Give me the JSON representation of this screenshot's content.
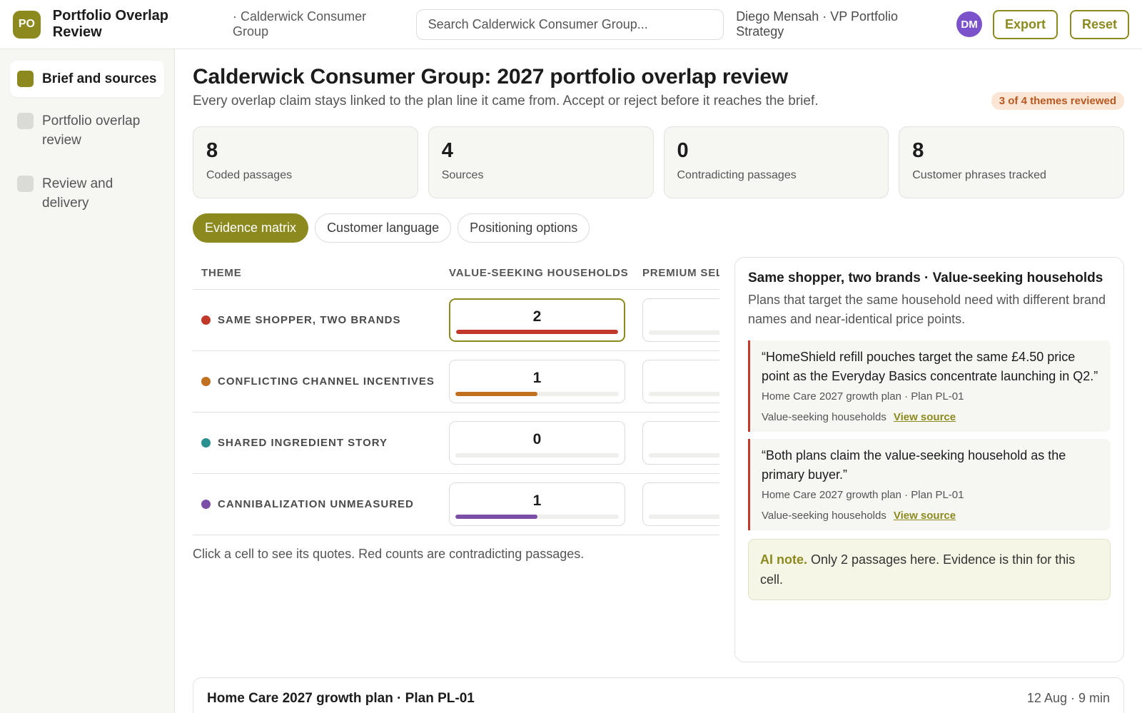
{
  "header": {
    "logo_text": "PO",
    "app_title": "Portfolio Overlap Review",
    "org_crumb": "· Calderwick Consumer Group",
    "search_placeholder": "Search Calderwick Consumer Group...",
    "user": "Diego Mensah · VP Portfolio Strategy",
    "avatar": "DM",
    "export_label": "Export",
    "reset_label": "Reset"
  },
  "sidebar": {
    "items": [
      {
        "label": "Brief and sources",
        "active": true
      },
      {
        "label": "Portfolio overlap review",
        "active": false
      },
      {
        "label": "Review and delivery",
        "active": false
      }
    ]
  },
  "main": {
    "title": "Calderwick Consumer Group: 2027 portfolio overlap review",
    "subtitle": "Every overlap claim stays linked to the plan line it came from. Accept or reject before it reaches the brief.",
    "review_badge": "3 of 4 themes reviewed",
    "stats": [
      {
        "value": "8",
        "label": "Coded passages"
      },
      {
        "value": "4",
        "label": "Sources"
      },
      {
        "value": "0",
        "label": "Contradicting passages"
      },
      {
        "value": "8",
        "label": "Customer phrases tracked"
      }
    ],
    "tabs": [
      {
        "label": "Evidence matrix",
        "active": true
      },
      {
        "label": "Customer language",
        "active": false
      },
      {
        "label": "Positioning options",
        "active": false
      }
    ]
  },
  "matrix": {
    "headers": {
      "theme": "THEME",
      "col1": "VALUE-SEEKING HOUSEHOLDS",
      "col2": "PREMIUM SELF-CARE"
    },
    "rows": [
      {
        "theme": "SAME SHOPPER, TWO BRANDS",
        "color": "#c0392b",
        "value": "2",
        "fill": 1.0,
        "selected": true
      },
      {
        "theme": "CONFLICTING CHANNEL INCENTIVES",
        "color": "#c0701f",
        "value": "1",
        "fill": 0.5,
        "selected": false
      },
      {
        "theme": "SHARED INGREDIENT STORY",
        "color": "#2a8f8f",
        "value": "0",
        "fill": 0.0,
        "selected": false
      },
      {
        "theme": "CANNIBALIZATION UNMEASURED",
        "color": "#7b4fa8",
        "value": "1",
        "fill": 0.5,
        "selected": false
      }
    ],
    "note": "Click a cell to see its quotes. Red counts are contradicting passages."
  },
  "panel": {
    "title": "Same shopper, two brands · Value-seeking households",
    "description": "Plans that target the same household need with different brand names and near-identical price points.",
    "quotes": [
      {
        "text": "“HomeShield refill pouches target the same £4.50 price point as the Everyday Basics concentrate launching in Q2.”",
        "source": "Home Care 2027 growth plan · Plan PL-01",
        "segment": "Value-seeking households",
        "link": "View source"
      },
      {
        "text": "“Both plans claim the value-seeking household as the primary buyer.”",
        "source": "Home Care 2027 growth plan · Plan PL-01",
        "segment": "Value-seeking households",
        "link": "View source"
      }
    ],
    "ai_label": "AI note.",
    "ai_text": "Only 2 passages here. Evidence is thin for this cell."
  },
  "source_card": {
    "title": "Home Care 2027 growth plan · Plan PL-01",
    "meta": "12 Aug · 9 min"
  },
  "colors": {
    "accent": "#8c8a1e",
    "avatar": "#7b52c9",
    "badge_bg": "#fbe6d6",
    "badge_text": "#b8581f",
    "contradiction": "#c0392b"
  }
}
